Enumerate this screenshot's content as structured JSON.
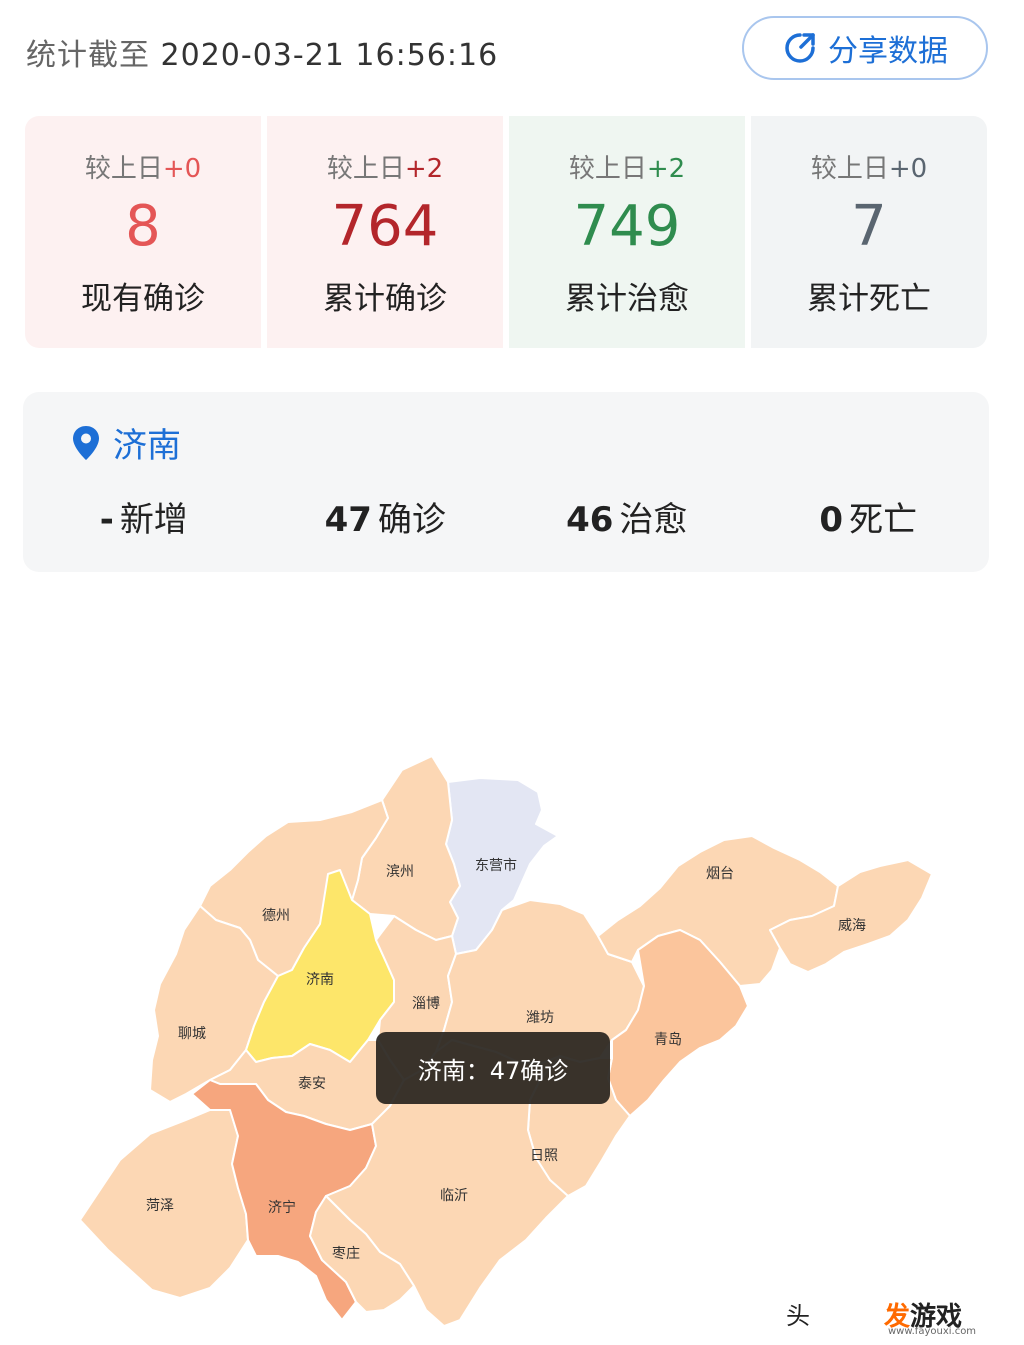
{
  "header": {
    "update_prefix": "统计截至",
    "update_time": "2020-03-21 16:56:16",
    "share_label": "分享数据"
  },
  "stats": [
    {
      "delta_label": "较上日",
      "delta": "+0",
      "value": "8",
      "label": "现有确诊",
      "delta_color": "#e45656",
      "value_color": "#e45656"
    },
    {
      "delta_label": "较上日",
      "delta": "+2",
      "value": "764",
      "label": "累计确诊",
      "delta_color": "#b3262b",
      "value_color": "#b3262b"
    },
    {
      "delta_label": "较上日",
      "delta": "+2",
      "value": "749",
      "label": "累计治愈",
      "delta_color": "#2f8c4e",
      "value_color": "#2f8c4e"
    },
    {
      "delta_label": "较上日",
      "delta": "+0",
      "value": "7",
      "label": "累计死亡",
      "delta_color": "#5a6570",
      "value_color": "#5a6570"
    }
  ],
  "region": {
    "name": "济南",
    "new": "-",
    "new_label": "新增",
    "confirmed": "47",
    "confirmed_label": "确诊",
    "cured": "46",
    "cured_label": "治愈",
    "dead": "0",
    "dead_label": "死亡"
  },
  "map": {
    "cities": [
      "东营市",
      "滨州",
      "烟台",
      "德州",
      "威海",
      "济南",
      "淄博",
      "潍坊",
      "聊城",
      "青岛",
      "泰安",
      "日照",
      "菏泽",
      "济宁",
      "临沂",
      "枣庄"
    ],
    "colors": {
      "light": "#fcd7b4",
      "mid": "#fbc59c",
      "strong": "#f6a67e",
      "highlight": "#fde66a",
      "none": "#e3e6f3"
    },
    "tooltip": "济南：47确诊"
  },
  "watermark": {
    "left": "头",
    "brand_a": "发",
    "brand_b": "游戏",
    "url": "www.fayouxi.com"
  }
}
